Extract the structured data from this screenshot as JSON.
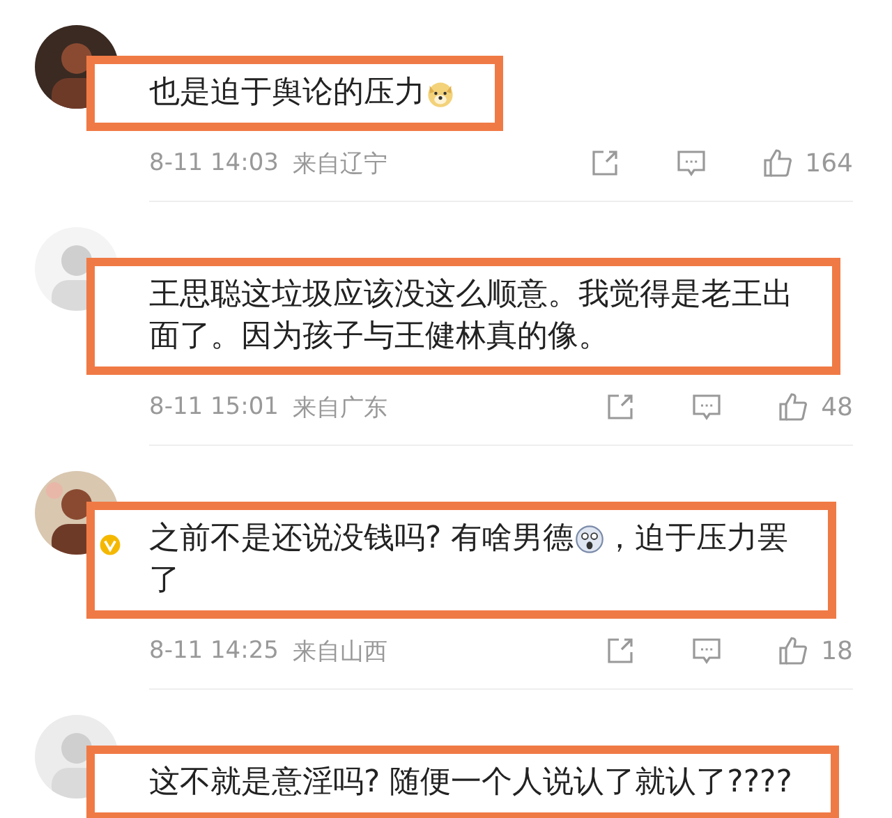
{
  "comments": [
    {
      "avatar": {
        "kind": "picture"
      },
      "verified": false,
      "lines": [
        [
          {
            "kind": "text",
            "text": "也是迫于舆论的压力"
          },
          {
            "kind": "dog-emoji"
          }
        ]
      ],
      "time": "8-11 14:03",
      "location": "来自辽宁",
      "likes": "164"
    },
    {
      "avatar": {
        "kind": "picture"
      },
      "verified": false,
      "lines": [
        [
          {
            "kind": "text",
            "text": "王思聪这垃圾应该没这么顺意。我觉得是老王出"
          }
        ],
        [
          {
            "kind": "text",
            "text": "面了。因为孩子与王健林真的像。"
          }
        ]
      ],
      "time": "8-11 15:01",
      "location": "来自广东",
      "likes": "48"
    },
    {
      "avatar": {
        "kind": "picture"
      },
      "verified": true,
      "lines": [
        [
          {
            "kind": "text",
            "text": "之前不是还说没钱吗? 有啥男德"
          },
          {
            "kind": "shocked-emoji"
          },
          {
            "kind": "text",
            "text": "，迫于压力罢"
          }
        ],
        [
          {
            "kind": "text",
            "text": "了"
          }
        ]
      ],
      "time": "8-11 14:25",
      "location": "来自山西",
      "likes": "18"
    },
    {
      "avatar": {
        "kind": "picture"
      },
      "verified": false,
      "lines": [
        [
          {
            "kind": "text",
            "text": "这不就是意淫吗? 随便一个人说认了就认了????"
          }
        ]
      ]
    }
  ]
}
